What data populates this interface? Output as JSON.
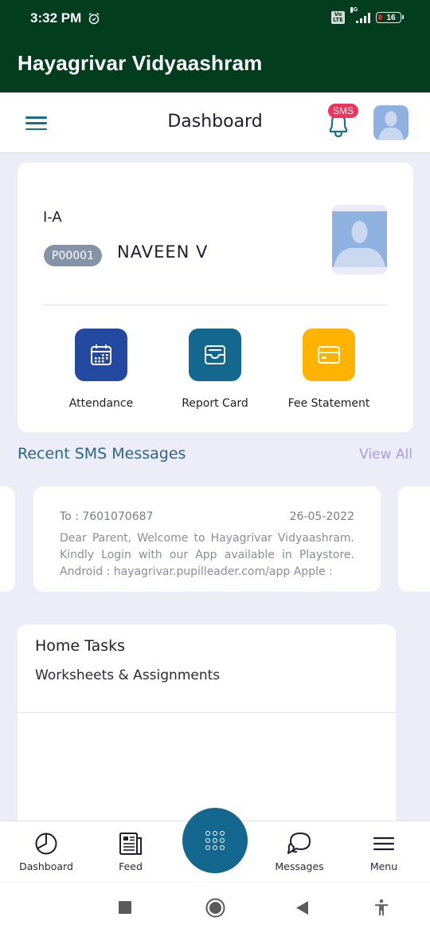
{
  "status_bar": {
    "time": "3:32 PM",
    "alarm_icon": "alarm-clock-icon",
    "volte": "Vo LTE",
    "network": "4G",
    "battery": "16"
  },
  "app": {
    "title": "Hayagrivar Vidyaashram"
  },
  "header": {
    "title": "Dashboard",
    "notification_badge": "SMS",
    "menu_icon": "hamburger-menu-icon",
    "bell_icon": "bell-icon",
    "avatar_icon": "user-avatar-icon"
  },
  "student": {
    "class": "I-A",
    "id": "P00001",
    "name": "NAVEEN V"
  },
  "quick_actions": [
    {
      "label": "Attendance",
      "icon": "calendar-icon",
      "color": "#234aa0"
    },
    {
      "label": "Report Card",
      "icon": "inbox-tray-icon",
      "color": "#14678f"
    },
    {
      "label": "Fee Statement",
      "icon": "credit-card-icon",
      "color": "#fdb300"
    }
  ],
  "recent_sms": {
    "title": "Recent SMS Messages",
    "view_all": "View All",
    "messages": [
      {
        "to": "To : 7601070687",
        "date": "26-05-2022",
        "body": "Dear Parent, Welcome to Hayagrivar Vidyaashram. Kindly Login with our App available in Playstore. Android : hayagrivar.pupilleader.com/app Apple :"
      }
    ]
  },
  "home_tasks": {
    "title": "Home Tasks",
    "subtitle": "Worksheets & Assignments"
  },
  "bottom_nav": [
    {
      "label": "Dashboard",
      "icon": "pie-chart-icon"
    },
    {
      "label": "Feed",
      "icon": "newspaper-icon"
    },
    {
      "label": "",
      "icon": "apps-grid-icon"
    },
    {
      "label": "Messages",
      "icon": "chat-bubbles-icon"
    },
    {
      "label": "Menu",
      "icon": "menu-lines-icon"
    }
  ],
  "system_nav": [
    "recents-square-icon",
    "home-circle-icon",
    "back-triangle-icon",
    "accessibility-icon"
  ],
  "colors": {
    "app_bar": "#033d20",
    "primary": "#14678f",
    "badge": "#f0335c",
    "view_all": "#a99be0",
    "background": "#ecedf6"
  }
}
